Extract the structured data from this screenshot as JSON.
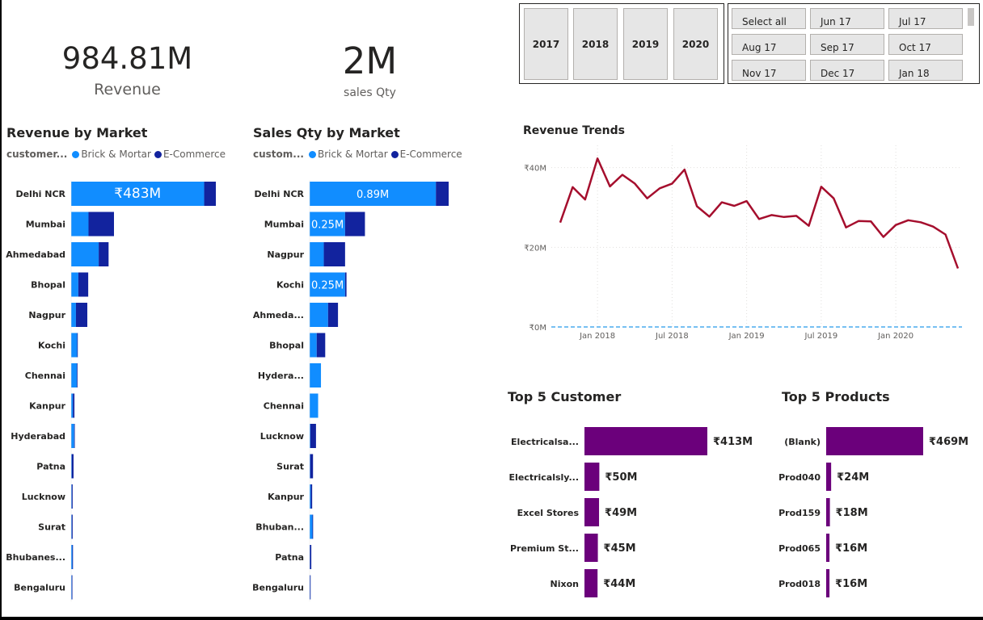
{
  "kpis": {
    "revenue": {
      "value": "984.81M",
      "label": "Revenue"
    },
    "sales_qty": {
      "value": "2M",
      "label": "sales Qty"
    }
  },
  "year_slicer": {
    "items": [
      "2017",
      "2018",
      "2019",
      "2020"
    ]
  },
  "month_slicer": {
    "items": [
      "Select all",
      "Jun 17",
      "Jul 17",
      "Aug 17",
      "Sep 17",
      "Oct 17",
      "Nov 17",
      "Dec 17",
      "Jan 18"
    ]
  },
  "colors": {
    "brick_mortar": "#118dff",
    "ecommerce": "#12239e",
    "line": "#a50e2d",
    "purple": "#6b007b",
    "zero_line": "#77c0f2"
  },
  "revenue_by_market": {
    "title": "Revenue by Market",
    "legend_title": "customer...",
    "legend": [
      "Brick & Mortar",
      "E-Commerce"
    ]
  },
  "sales_qty_by_market": {
    "title": "Sales Qty by Market",
    "legend_title": "custom...",
    "legend": [
      "Brick & Mortar",
      "E-Commerce"
    ]
  },
  "revenue_trends": {
    "title": "Revenue Trends"
  },
  "top5_customer": {
    "title": "Top 5 Customer"
  },
  "top5_products": {
    "title": "Top 5 Products"
  },
  "chart_data": [
    {
      "id": "revenue_by_market",
      "type": "bar",
      "orientation": "horizontal",
      "stacked": true,
      "unit": "₹M",
      "categories": [
        "Delhi NCR",
        "Mumbai",
        "Ahmedabad",
        "Bhopal",
        "Nagpur",
        "Kochi",
        "Chennai",
        "Kanpur",
        "Hyderabad",
        "Patna",
        "Lucknow",
        "Surat",
        "Bhubanes...",
        "Bengaluru"
      ],
      "series": [
        {
          "name": "Brick & Mortar",
          "values": [
            444,
            58,
            92,
            24,
            16,
            20,
            19,
            6,
            10,
            2,
            2,
            2,
            4,
            2
          ]
        },
        {
          "name": "E-Commerce",
          "values": [
            39,
            85,
            33,
            33,
            38,
            2,
            1,
            5,
            1,
            6,
            3,
            3,
            1,
            1
          ]
        }
      ],
      "data_labels": [
        "₹483M"
      ],
      "xlim": [
        0,
        483
      ]
    },
    {
      "id": "sales_qty_by_market",
      "type": "bar",
      "orientation": "horizontal",
      "stacked": true,
      "unit": "M",
      "categories": [
        "Delhi NCR",
        "Mumbai",
        "Nagpur",
        "Kochi",
        "Ahmeda...",
        "Bhopal",
        "Hydera...",
        "Chennai",
        "Lucknow",
        "Surat",
        "Kanpur",
        "Bhuban...",
        "Patna",
        "Bengaluru"
      ],
      "series": [
        {
          "name": "Brick & Mortar",
          "values": [
            0.89,
            0.25,
            0.1,
            0.25,
            0.13,
            0.05,
            0.08,
            0.06,
            0.005,
            0.004,
            0.008,
            0.02,
            0.002,
            0.002
          ]
        },
        {
          "name": "E-Commerce",
          "values": [
            0.09,
            0.14,
            0.15,
            0.01,
            0.07,
            0.06,
            0.0,
            0.0,
            0.04,
            0.02,
            0.01,
            0.001,
            0.01,
            0.005
          ]
        }
      ],
      "data_labels": [
        "0.89M",
        "0.25M",
        "",
        "0.25M"
      ],
      "xlim": [
        0,
        0.98
      ]
    },
    {
      "id": "revenue_trends",
      "type": "line",
      "x": [
        "Oct 2017",
        "Nov 2017",
        "Dec 2017",
        "Jan 2018",
        "Feb 2018",
        "Mar 2018",
        "Apr 2018",
        "May 2018",
        "Jun 2018",
        "Jul 2018",
        "Aug 2018",
        "Sep 2018",
        "Oct 2018",
        "Nov 2018",
        "Dec 2018",
        "Jan 2019",
        "Feb 2019",
        "Mar 2019",
        "Apr 2019",
        "May 2019",
        "Jun 2019",
        "Jul 2019",
        "Aug 2019",
        "Sep 2019",
        "Oct 2019",
        "Nov 2019",
        "Dec 2019",
        "Jan 2020",
        "Feb 2020",
        "Mar 2020",
        "Apr 2020",
        "May 2020",
        "Jun 2020"
      ],
      "series": [
        {
          "values": [
            26.2,
            35.1,
            32.0,
            42.3,
            35.3,
            38.2,
            36.0,
            32.3,
            34.8,
            36.0,
            39.5,
            30.3,
            27.7,
            31.3,
            30.4,
            31.6,
            27.1,
            28.1,
            27.6,
            27.9,
            25.4,
            35.2,
            32.3,
            25.0,
            26.6,
            26.5,
            22.6,
            25.6,
            26.8,
            26.3,
            25.2,
            23.2,
            14.7
          ]
        }
      ],
      "xticks": [
        "Jan 2018",
        "Jul 2018",
        "Jan 2019",
        "Jul 2019",
        "Jan 2020"
      ],
      "yticks": [
        "₹0M",
        "₹20M",
        "₹40M"
      ],
      "ylim": [
        0,
        45
      ],
      "grid": true
    },
    {
      "id": "top5_customer",
      "type": "bar",
      "orientation": "horizontal",
      "categories": [
        "Electricalsa...",
        "Electricalsly...",
        "Excel Stores",
        "Premium St...",
        "Nixon"
      ],
      "values": [
        413,
        50,
        49,
        45,
        44
      ],
      "data_labels": [
        "₹413M",
        "₹50M",
        "₹49M",
        "₹45M",
        "₹44M"
      ],
      "unit": "₹M"
    },
    {
      "id": "top5_products",
      "type": "bar",
      "orientation": "horizontal",
      "categories": [
        "(Blank)",
        "Prod040",
        "Prod159",
        "Prod065",
        "Prod018"
      ],
      "values": [
        469,
        24,
        18,
        16,
        16
      ],
      "data_labels": [
        "₹469M",
        "₹24M",
        "₹18M",
        "₹16M",
        "₹16M"
      ],
      "unit": "₹M"
    }
  ]
}
